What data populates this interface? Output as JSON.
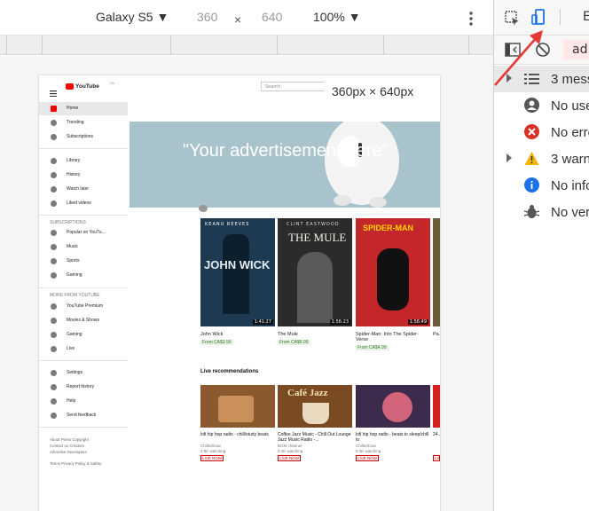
{
  "device_toolbar": {
    "device": "Galaxy S5",
    "width": "360",
    "times": "×",
    "height": "640",
    "zoom": "100%",
    "size_badge": "360px × 640px"
  },
  "youtube": {
    "logo": "YouTube",
    "logo_suffix": "CA",
    "search_placeholder": "Search",
    "sidebar": {
      "main": [
        "Home",
        "Trending",
        "Subscriptions"
      ],
      "library": [
        "Library",
        "History",
        "Watch later",
        "Liked videos"
      ],
      "subscriptions_header": "SUBSCRIPTIONS",
      "subscriptions": [
        "Popular on YouTu...",
        "Music",
        "Sports",
        "Gaming"
      ],
      "more_header": "MORE FROM YOUTUBE",
      "more": [
        "YouTube Premium",
        "Movies & Shows",
        "Gaming",
        "Live"
      ],
      "settings": [
        "Settings",
        "Report history",
        "Help",
        "Send feedback"
      ],
      "footer": [
        "About  Press  Copyright",
        "Contact us  Creators",
        "Advertise  Developers",
        "Terms  Privacy  Policy & Safety"
      ]
    },
    "ad_text": "\"Your advertisement here\"",
    "movies": [
      {
        "title": "John Wick",
        "price": "From CA$3.99",
        "duration": "1:41:27",
        "poster": "JOHN WICK",
        "top": "KEANU REEVES",
        "color": "#1d3a52"
      },
      {
        "title": "The Mule",
        "price": "From CA$6.99",
        "duration": "1:56:23",
        "poster": "THE MULE",
        "top": "CLINT EASTWOOD",
        "color": "#2b2b2b"
      },
      {
        "title": "Spider-Man: Into The Spider-Verse",
        "price": "From CA$4.99",
        "duration": "1:56:49",
        "poster": "SPIDER-MAN",
        "top": "",
        "color": "#c4272a"
      },
      {
        "title": "Pa... Gr...",
        "price": "",
        "duration": "",
        "poster": "",
        "top": "",
        "color": "#6b5c3a"
      }
    ],
    "live_header": "Live recommendations",
    "live": [
      {
        "title": "lofi hip hop radio - chill/study beats",
        "channel": "ChilledCow",
        "meta": "3.9K watching",
        "badge": "LIVE NOW",
        "thumb": "",
        "color": "#8a5a2e"
      },
      {
        "title": "Coffee Jazz Music - Chill Out Lounge Jazz Music Radio -...",
        "channel": "BGM channel",
        "meta": "3.4K watching",
        "badge": "LIVE NOW",
        "thumb": "Café Jazz",
        "color": "#7a4b23"
      },
      {
        "title": "lofi hip hop radio - beats to sleep/chill to",
        "channel": "ChilledCow",
        "meta": "5.3K watching",
        "badge": "LIVE NOW",
        "thumb": "",
        "color": "#3d2a4d"
      },
      {
        "title": "24...",
        "channel": "",
        "meta": "",
        "badge": "LIVE",
        "thumb": "",
        "color": "#d61f1f"
      }
    ]
  },
  "console": {
    "filter": "ad.",
    "rows": [
      {
        "label": "3 mess",
        "icon": "list-icon",
        "color": "#555"
      },
      {
        "label": "No use",
        "icon": "user-icon",
        "color": "#555"
      },
      {
        "label": "No erro",
        "icon": "error-icon",
        "color": "#d93025"
      },
      {
        "label": "3 warn",
        "icon": "warning-icon",
        "color": "#f2b600"
      },
      {
        "label": "No info",
        "icon": "info-icon",
        "color": "#1a73e8"
      },
      {
        "label": "No ver",
        "icon": "bug-icon",
        "color": "#555"
      }
    ],
    "tab_letter": "E"
  }
}
